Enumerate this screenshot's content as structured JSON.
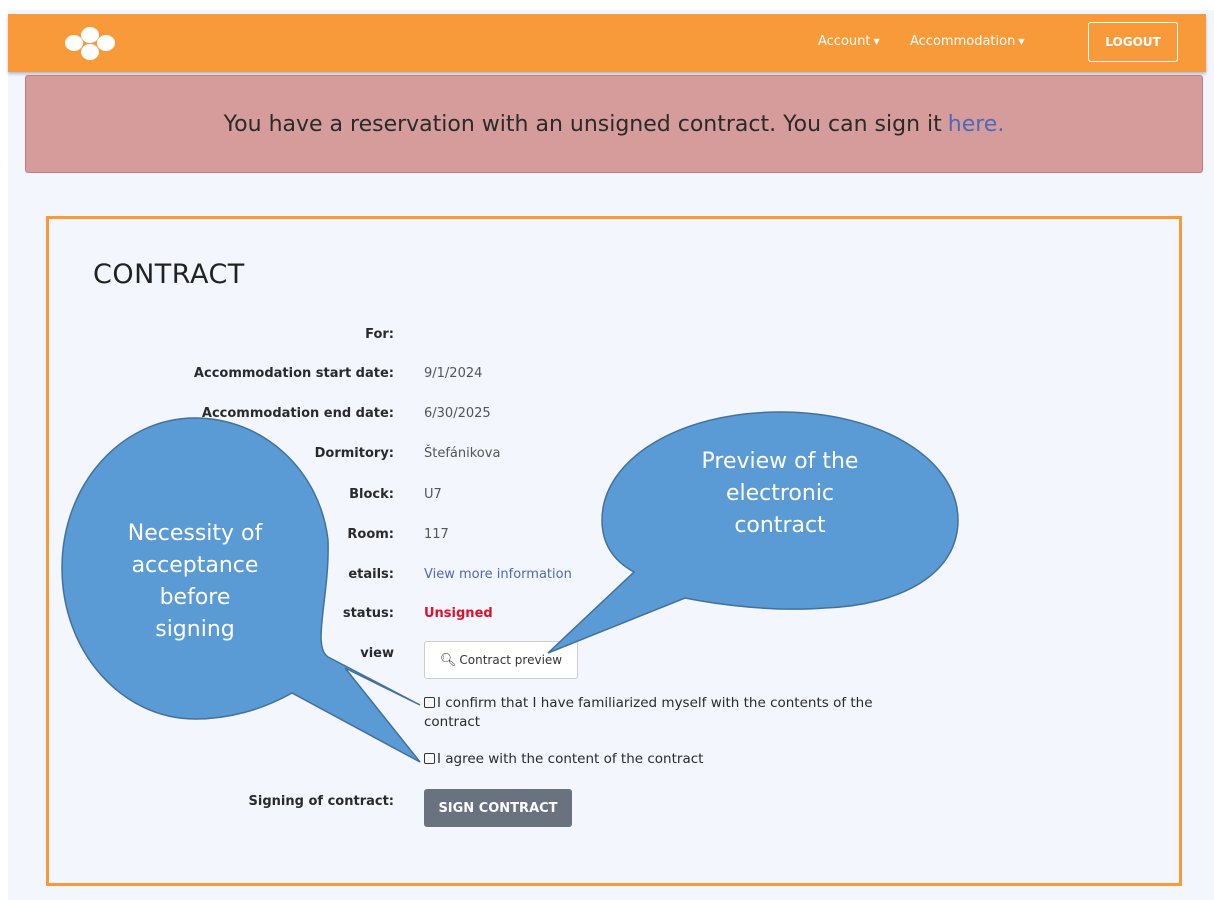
{
  "navbar": {
    "account_label": "Account",
    "accommodation_label": "Accommodation",
    "logout_label": "LOGOUT"
  },
  "alert": {
    "text": "You have a reservation with an unsigned contract. You can sign it",
    "link_text": "here."
  },
  "contract": {
    "title": "CONTRACT",
    "rows": [
      {
        "label": "For:",
        "value": ""
      },
      {
        "label": "Accommodation start date:",
        "value": "9/1/2024"
      },
      {
        "label": "Accommodation end date:",
        "value": "6/30/2025"
      },
      {
        "label": "Dormitory:",
        "value": "Štefánikova"
      },
      {
        "label": "Block:",
        "value": "U7"
      },
      {
        "label": "Room:",
        "value": "117"
      },
      {
        "label": "etails:",
        "value": "View more information"
      },
      {
        "label": "status:",
        "value": "Unsigned"
      },
      {
        "label": "view",
        "value": ""
      }
    ],
    "preview_button_label": "Contract preview",
    "confirm_checkbox_label": "I confirm that I have familiarized myself with the contents of the contract",
    "agree_checkbox_label": "I agree with the content of the contract",
    "signing_label": "Signing of contract:",
    "sign_button_label": "SIGN CONTRACT"
  },
  "callouts": {
    "left_line1": "Necessity of",
    "left_line2": "acceptance",
    "left_line3": "before",
    "left_line4": "signing",
    "right_line1": "Preview of the",
    "right_line2": "electronic",
    "right_line3": "contract"
  },
  "colors": {
    "navbar": "#f99a3a",
    "alert_bg": "#d59c9b",
    "link": "#4f68b8",
    "unsigned": "#e0102a",
    "callout_fill": "#5b9bd5",
    "callout_stroke": "#41719c"
  }
}
